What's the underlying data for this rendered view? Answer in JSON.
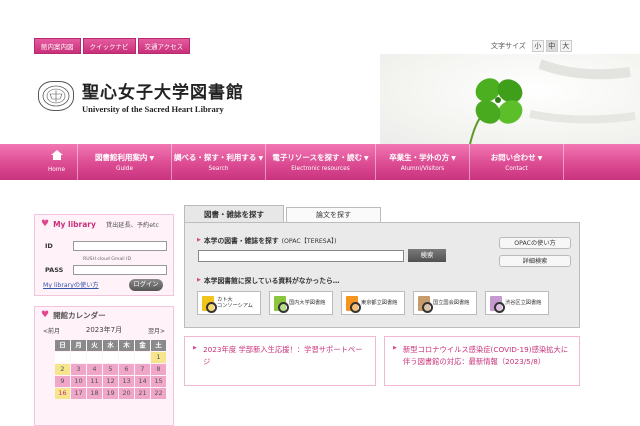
{
  "toplinks": [
    "館内案内図",
    "クイックナビ",
    "交通アクセス"
  ],
  "fontsize": {
    "label": "文字サイズ",
    "small": "小",
    "medium": "中",
    "large": "大"
  },
  "logo": {
    "jp": "聖心女子大学図書館",
    "en": "University of the Sacred Heart Library"
  },
  "nav": {
    "home": "Home",
    "items": [
      {
        "jp": "図書館利用案内",
        "en": "Guide"
      },
      {
        "jp": "調べる・探す・利用する",
        "en": "Search"
      },
      {
        "jp": "電子リソースを探す・読む",
        "en": "Electronic resources"
      },
      {
        "jp": "卒業生・学外の方",
        "en": "Alumni/Visitors"
      },
      {
        "jp": "お問い合わせ",
        "en": "Contact"
      }
    ]
  },
  "mylibrary": {
    "title": "My library",
    "subtitle": "貸出延長、予約etc",
    "id_label": "ID",
    "pass_label": "PASS",
    "note": "RUSH cloud Gmail ID",
    "usage_link": "My libraryの使い方",
    "login": "ログイン"
  },
  "calendar": {
    "title": "開館カレンダー",
    "prev": "<前月",
    "month": "2023年7月",
    "next": "翌月>",
    "weekdays": [
      "日",
      "月",
      "火",
      "水",
      "木",
      "金",
      "土"
    ],
    "rows": [
      [
        "",
        "",
        "",
        "",
        "",
        "",
        "1"
      ],
      [
        "2",
        "3",
        "4",
        "5",
        "6",
        "7",
        "8"
      ],
      [
        "9",
        "10",
        "11",
        "12",
        "13",
        "14",
        "15"
      ],
      [
        "16",
        "17",
        "18",
        "19",
        "20",
        "21",
        "22"
      ]
    ]
  },
  "search": {
    "tab_books": "図書・雑誌を探す",
    "tab_papers": "論文を探す",
    "opac_label": "本学の図書・雑誌を探す",
    "opac_sub": "(OPAC【TERESA】)",
    "search_button": "検索",
    "opac_howto": "OPACの使い方",
    "advanced": "詳細検索",
    "other_label": "本学図書館に探している資料がなかったら…",
    "libraries": [
      {
        "name": "カト大\nコンソーシアム",
        "color": "#f0c419"
      },
      {
        "name": "国内大学図書館",
        "color": "#8cc63f"
      },
      {
        "name": "東京都立図書館",
        "color": "#f7941d"
      },
      {
        "name": "国立国会図書館",
        "color": "#c69c6d"
      },
      {
        "name": "渋谷区立図書館",
        "color": "#c49ad0"
      }
    ]
  },
  "news": [
    "2023年度 学部新入生応援！：学習サポートページ",
    "新型コロナウイルス感染症(COVID-19)感染拡大に伴う図書館の対応：最新情報（2023/5/8）"
  ]
}
